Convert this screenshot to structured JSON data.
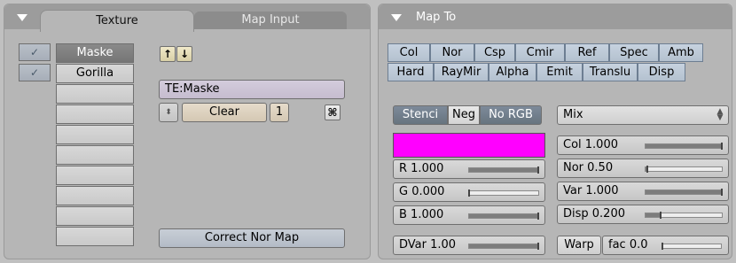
{
  "left_panel": {
    "tabs": {
      "active": "Texture",
      "inactive": "Map Input"
    },
    "slots": [
      {
        "label": "Maske",
        "checked": true,
        "selected": true
      },
      {
        "label": "Gorilla",
        "checked": true,
        "selected": false
      },
      {
        "label": "",
        "checked": false,
        "selected": false
      },
      {
        "label": "",
        "checked": false,
        "selected": false
      },
      {
        "label": "",
        "checked": false,
        "selected": false
      },
      {
        "label": "",
        "checked": false,
        "selected": false
      },
      {
        "label": "",
        "checked": false,
        "selected": false
      },
      {
        "label": "",
        "checked": false,
        "selected": false
      },
      {
        "label": "",
        "checked": false,
        "selected": false
      },
      {
        "label": "",
        "checked": false,
        "selected": false
      }
    ],
    "check_glyph": "✓",
    "texture_name": "TE:Maske",
    "clear_label": "Clear",
    "users_count": "1",
    "correct_nor_label": "Correct Nor Map"
  },
  "right_panel": {
    "title": "Map To",
    "row1": [
      "Col",
      "Nor",
      "Csp",
      "Cmir",
      "Ref",
      "Spec",
      "Amb"
    ],
    "row2": [
      "Hard",
      "RayMir",
      "Alpha",
      "Emit",
      "Translu",
      "Disp"
    ],
    "stencil_label": "Stenci",
    "neg_label": "Neg",
    "norgb_label": "No RGB",
    "blend_mode": "Mix",
    "color_hex": "#ff00ff",
    "rgb": {
      "r": {
        "label": "R 1.000",
        "value": 1.0
      },
      "g": {
        "label": "G 0.000",
        "value": 0.0
      },
      "b": {
        "label": "B 1.000",
        "value": 1.0
      }
    },
    "factors": [
      {
        "label": "Col 1.000",
        "value": 1.0
      },
      {
        "label": "Nor 0.50",
        "value": 0.02
      },
      {
        "label": "Var 1.000",
        "value": 1.0
      },
      {
        "label": "Disp 0.200",
        "value": 0.2
      }
    ],
    "dvar": {
      "label": "DVar 1.00",
      "value": 1.0
    },
    "warp_label": "Warp",
    "warp_fac": {
      "label": "fac 0.0",
      "value": 0.0
    }
  },
  "colors": {
    "selected_slot": "#7e7e7e",
    "map_toggle": "#bcc7d4",
    "accent_color": "#ff00ff"
  }
}
